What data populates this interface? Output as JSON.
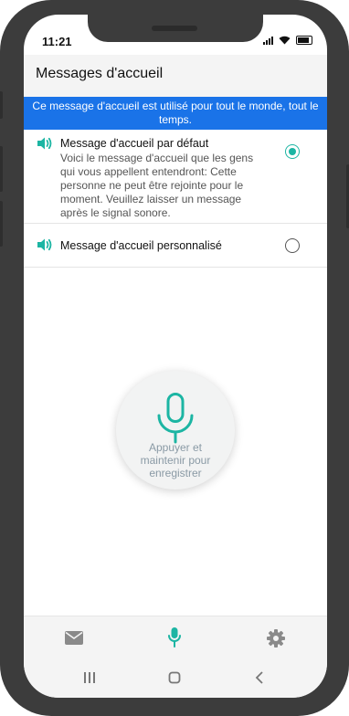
{
  "status": {
    "time": "11:21"
  },
  "header": {
    "title": "Messages d'accueil"
  },
  "banner": {
    "text": "Ce message d'accueil est utilisé pour tout le monde, tout le temps."
  },
  "options": [
    {
      "title": "Message d'accueil par défaut",
      "description": "Voici le message d'accueil que les gens qui vous appellent entendront: Cette personne ne peut être rejointe pour le moment. Veuillez laisser un message après le signal sonore.",
      "selected": true
    },
    {
      "title": "Message d'accueil personnalisé",
      "selected": false
    }
  ],
  "record": {
    "label": "Appuyer et\nmaintenir pour\nenregistrer"
  },
  "tabs": [
    {
      "icon": "envelope-icon",
      "active": false
    },
    {
      "icon": "microphone-icon",
      "active": true
    },
    {
      "icon": "gear-icon",
      "active": false
    }
  ],
  "colors": {
    "accent": "#1cb5a3",
    "banner": "#1a73e8",
    "inactive_icon": "#8a8a8a"
  }
}
